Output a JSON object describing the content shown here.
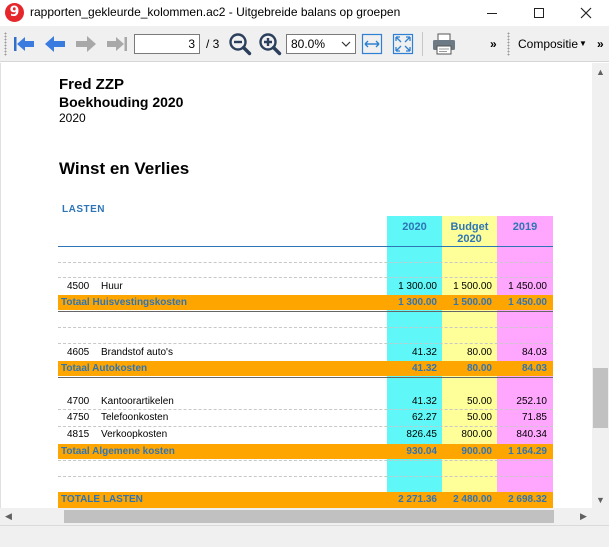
{
  "window": {
    "title": "rapporten_gekleurde_kolommen.ac2 - Uitgebreide balans op groepen",
    "app_icon_glyph": "9"
  },
  "toolbar": {
    "page_current": "3",
    "page_total": "/ 3",
    "zoom": "80.0%",
    "overflow_glyph": "»",
    "overflow2_glyph": "»",
    "layout_label": "Compositie",
    "layout_dropdown_glyph": "▼"
  },
  "report": {
    "company": "Fred ZZP",
    "book": "Boekhouding 2020",
    "year": "2020",
    "section": "Winst en Verlies",
    "group_label": "LASTEN",
    "columns": {
      "c1": "2020",
      "c2_line1": "Budget",
      "c2_line2": "2020",
      "c3": "2019"
    },
    "rows": [
      {
        "code": "4500",
        "name": "Huur",
        "v2020": "1 300.00",
        "budget": "1 500.00",
        "v2019": "1 450.00"
      },
      {
        "code": "4605",
        "name": "Brandstof auto's",
        "v2020": "41.32",
        "budget": "80.00",
        "v2019": "84.03"
      },
      {
        "code": "4700",
        "name": "Kantoorartikelen",
        "v2020": "41.32",
        "budget": "50.00",
        "v2019": "252.10"
      },
      {
        "code": "4750",
        "name": "Telefoonkosten",
        "v2020": "62.27",
        "budget": "50.00",
        "v2019": "71.85"
      },
      {
        "code": "4815",
        "name": "Verkoopkosten",
        "v2020": "826.45",
        "budget": "800.00",
        "v2019": "840.34"
      }
    ],
    "totals": [
      {
        "label": "Totaal Huisvestingskosten",
        "v2020": "1 300.00",
        "budget": "1 500.00",
        "v2019": "1 450.00"
      },
      {
        "label": "Totaal Autokosten",
        "v2020": "41.32",
        "budget": "80.00",
        "v2019": "84.03"
      },
      {
        "label": "Totaal Algemene kosten",
        "v2020": "930.04",
        "budget": "900.00",
        "v2019": "1 164.29"
      },
      {
        "label": "TOTALE LASTEN",
        "v2020": "2 271.36",
        "budget": "2 480.00",
        "v2019": "2 698.32"
      }
    ]
  },
  "colors": {
    "accent_blue": "#2e75b6",
    "col_2020": "#5ff7f7",
    "col_budget": "#ffff99",
    "col_2019": "#ffa6ff",
    "total_bar": "#ffa500"
  }
}
